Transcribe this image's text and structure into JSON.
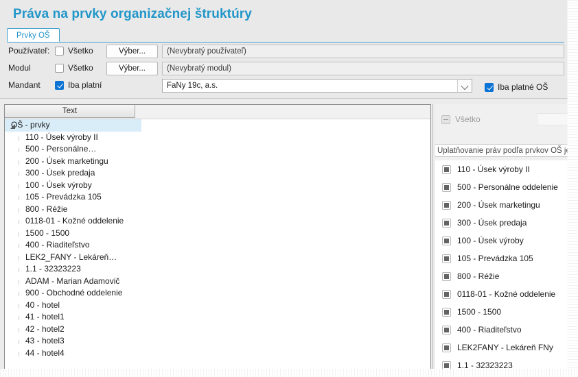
{
  "header": {
    "title": "Práva na prvky organizačnej štruktúry",
    "tab": "Prvky OŠ"
  },
  "form": {
    "rows": [
      {
        "label": "Používateľ:",
        "checkbox_label": "Všetko",
        "checkbox_state": "unchecked",
        "button": "Výber...",
        "field_value": "(Nevybratý používateľ)",
        "field_state": "disabled"
      },
      {
        "label": "Modul",
        "checkbox_label": "Všetko",
        "checkbox_state": "unchecked",
        "button": "Výber...",
        "field_value": "(Nevybratý modul)",
        "field_state": "disabled"
      },
      {
        "label": "Mandant",
        "checkbox_label": "Iba platní",
        "checkbox_state": "checked",
        "button": "",
        "field_value": "FaNy 19c, a.s.",
        "field_state": "editable"
      }
    ],
    "valid_os_checkbox": {
      "label": "Iba platné OŠ",
      "state": "checked"
    },
    "combo_icon": "chevron-down-icon"
  },
  "tree": {
    "column_header": "Text",
    "root": {
      "label": "OŠ - prvky",
      "expanded": true,
      "selected": true
    },
    "nodes": [
      "110 - Úsek výroby II",
      "500 -  Personálne…",
      "200 - Úsek marketingu",
      "300 - Úsek predaja",
      "100 - Úsek výroby",
      "105 - Prevádzka 105",
      "800 - Réžie",
      "0118-01 - Kožné oddelenie",
      "1500 - 1500",
      "400 - Riaditeľstvo",
      "LEK2_FANY -  Lekáreň…",
      "1.1 - 32323223",
      "ADAM - Marian Adamovič",
      "900 - Obchodné oddelenie",
      "40 - hotel",
      "41 - hotel1",
      "42 - hotel2",
      "43 - hotel3",
      "44 - hotel4"
    ]
  },
  "right_panel": {
    "all_checkbox_label": "Všetko",
    "all_checkbox_state": "indeterminate",
    "search_placeholder": "",
    "note": "Uplatňovanie práv podľa prvkov OŠ je",
    "items": [
      "110 - Úsek výroby II",
      "500 - Personálne oddelenie",
      "200 - Úsek marketingu",
      "300 - Úsek predaja",
      "100 - Úsek výroby",
      "105 - Prevádzka 105",
      "800 - Réžie",
      "0118-01 - Kožné oddelenie",
      "1500 - 1500",
      "400 - Riaditeľstvo",
      "LEK2FANY - Lekáreň FNy",
      "1.1 - 32323223"
    ],
    "item_checkbox_state": "filled-square"
  },
  "colors": {
    "title": "#2196c8",
    "tab_border": "#3a9ecb",
    "checkbox_checked": "#0a73d4",
    "selection": "#d9edf9",
    "panel_bg": "#e9e9ea"
  }
}
